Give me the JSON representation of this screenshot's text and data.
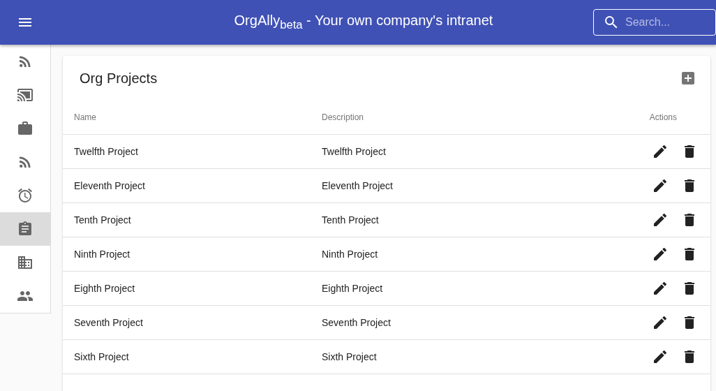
{
  "app_bar": {
    "title": "OrgAlly$_{beta}$ - Your own company's intranet",
    "search": {
      "placeholder": "Search..."
    }
  },
  "sidebar": {
    "items": [
      {
        "kind": "feed",
        "selected": false
      },
      {
        "kind": "cast",
        "selected": false
      },
      {
        "kind": "work",
        "selected": false
      },
      {
        "kind": "feed",
        "selected": false
      },
      {
        "kind": "alarm",
        "selected": false
      },
      {
        "kind": "assignment",
        "selected": true
      },
      {
        "kind": "business",
        "selected": false
      },
      {
        "kind": "people",
        "selected": false
      }
    ]
  },
  "card": {
    "title": "Org Projects",
    "table": {
      "columns": [
        "Name",
        "Description",
        "Actions"
      ],
      "rows": [
        {
          "name": "Twelfth Project",
          "description": "Twelfth Project"
        },
        {
          "name": "Eleventh Project",
          "description": "Eleventh Project"
        },
        {
          "name": "Tenth Project",
          "description": "Tenth Project"
        },
        {
          "name": "Ninth Project",
          "description": "Ninth Project"
        },
        {
          "name": "Eighth Project",
          "description": "Eighth Project"
        },
        {
          "name": "Seventh Project",
          "description": "Seventh Project"
        },
        {
          "name": "Sixth Project",
          "description": "Sixth Project"
        }
      ]
    }
  }
}
